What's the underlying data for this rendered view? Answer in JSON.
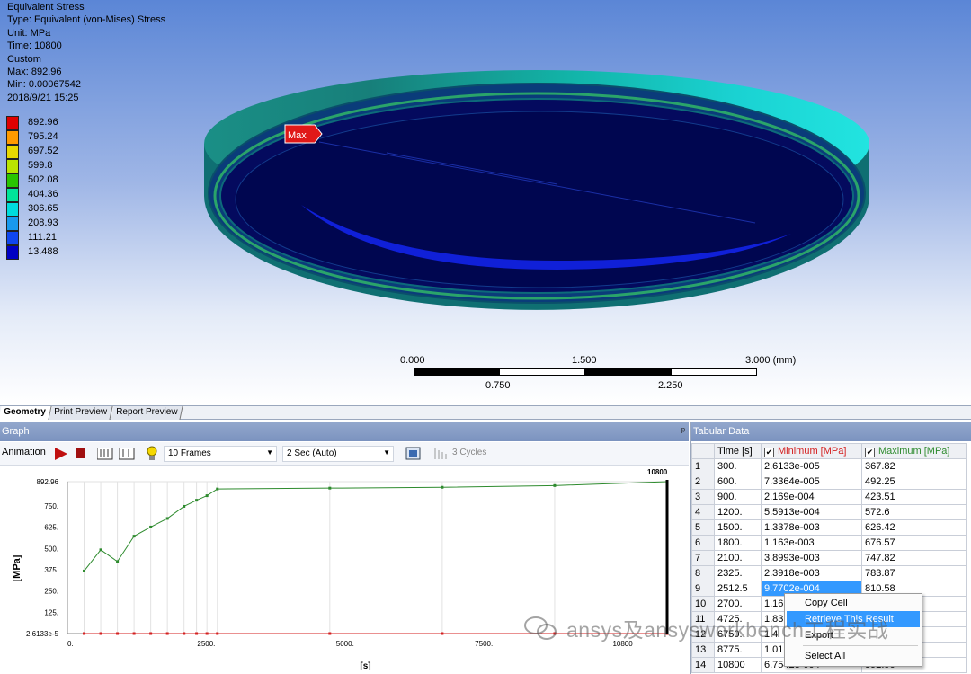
{
  "result_info": {
    "title": "Equivalent Stress",
    "type": "Type: Equivalent (von-Mises) Stress",
    "unit": "Unit: MPa",
    "time": "Time: 10800",
    "custom": "Custom",
    "max": "Max: 892.96",
    "min": "Min: 0.00067542",
    "date": "2018/9/21 15:25"
  },
  "legend": {
    "labels": [
      "892.96",
      "795.24",
      "697.52",
      "599.8",
      "502.08",
      "404.36",
      "306.65",
      "208.93",
      "111.21",
      "13.488"
    ],
    "colors": [
      "#e00000",
      "#ff9a00",
      "#e8d800",
      "#b9e400",
      "#29c400",
      "#00e49a",
      "#00dcdc",
      "#1899ee",
      "#1046ee",
      "#0000c4"
    ]
  },
  "probe": {
    "max_label": "Max"
  },
  "scale_bar": {
    "top_labels": [
      "0.000",
      "1.500",
      "3.000 (mm)"
    ],
    "bottom_labels": [
      "0.750",
      "2.250"
    ]
  },
  "tabs": [
    "Geometry",
    "Print Preview",
    "Report Preview"
  ],
  "graph": {
    "title": "Graph",
    "animation_label": "Animation",
    "frames": "10 Frames",
    "duration": "2 Sec (Auto)",
    "cycles": "3 Cycles",
    "pin": "ᵖ"
  },
  "chart_data": {
    "type": "line",
    "xlabel": "[s]",
    "ylabel": "[MPa]",
    "x": [
      300,
      600,
      900,
      1200,
      1500,
      1800,
      2100,
      2325,
      2512.5,
      2700,
      4725,
      6750,
      8775,
      10800
    ],
    "series": [
      {
        "name": "Maximum [MPa]",
        "color": "#2e8b2e",
        "values": [
          367.82,
          492.25,
          423.51,
          572.6,
          626.42,
          676.57,
          747.82,
          783.87,
          810.58,
          850.0,
          855.0,
          860.0,
          870.0,
          892.96
        ]
      },
      {
        "name": "Minimum [MPa]",
        "color": "#d42020",
        "values": [
          2.6133e-05,
          7.3364e-05,
          0.0002169,
          0.00055913,
          0.0013378,
          0.001163,
          0.0038993,
          0.0023918,
          0.00097702,
          0.0012,
          0.0012,
          0.001,
          0.001,
          0.00067542
        ]
      }
    ],
    "xlim": [
      0,
      10800
    ],
    "ylim": [
      0,
      892.96
    ],
    "x_ticks": [
      "0.",
      "2500.",
      "5000.",
      "7500.",
      "10800"
    ],
    "x_tick_values": [
      0,
      2500,
      5000,
      7500,
      10000
    ],
    "y_ticks": [
      "892.96",
      "750.",
      "625.",
      "500.",
      "375.",
      "250.",
      "125.",
      "2.6133e-5"
    ],
    "y_tick_values": [
      892.96,
      750,
      625,
      500,
      375,
      250,
      125,
      0
    ],
    "cursor_label": "10800",
    "grid": true
  },
  "tabular": {
    "title": "Tabular Data",
    "headers": {
      "time": "Time [s]",
      "min": "Minimum [MPa]",
      "max": "Maximum [MPa]"
    },
    "header_colors": {
      "min": "#d42020",
      "max": "#2e8b2e"
    },
    "rows": [
      [
        "1",
        "300.",
        "2.6133e-005",
        "367.82"
      ],
      [
        "2",
        "600.",
        "7.3364e-005",
        "492.25"
      ],
      [
        "3",
        "900.",
        "2.169e-004",
        "423.51"
      ],
      [
        "4",
        "1200.",
        "5.5913e-004",
        "572.6"
      ],
      [
        "5",
        "1500.",
        "1.3378e-003",
        "626.42"
      ],
      [
        "6",
        "1800.",
        "1.163e-003",
        "676.57"
      ],
      [
        "7",
        "2100.",
        "3.8993e-003",
        "747.82"
      ],
      [
        "8",
        "2325.",
        "2.3918e-003",
        "783.87"
      ],
      [
        "9",
        "2512.5",
        "9.7702e-004",
        "810.58"
      ],
      [
        "10",
        "2700.",
        "1.16",
        ""
      ],
      [
        "11",
        "4725.",
        "1.83",
        ""
      ],
      [
        "12",
        "6750.",
        "1.4",
        ""
      ],
      [
        "13",
        "8775.",
        "1.01",
        ""
      ],
      [
        "14",
        "10800",
        "6.7542e-004",
        "892.96"
      ]
    ]
  },
  "context_menu": [
    "Copy Cell",
    "Retrieve This Result",
    "Export",
    "Select All"
  ],
  "watermark": "ansys及ansysworkbench工程实战"
}
